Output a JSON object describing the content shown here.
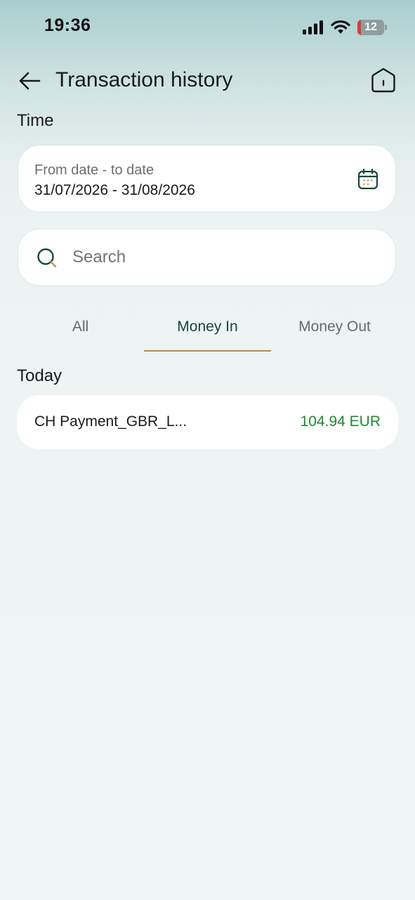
{
  "status_bar": {
    "time": "19:36",
    "battery_level": "12",
    "battery_fraction": 0.12,
    "icons": [
      "signal-icon",
      "wifi-icon",
      "battery-icon"
    ]
  },
  "header": {
    "title": "Transaction history",
    "back_icon": "arrow-left-icon",
    "home_icon": "home-icon"
  },
  "filters": {
    "time_label": "Time",
    "date_range": {
      "placeholder": "From date - to date",
      "value": "31/07/2026 - 31/08/2026",
      "icon": "calendar-icon"
    },
    "search": {
      "placeholder": "Search",
      "value": "",
      "icon": "search-icon"
    }
  },
  "tabs": {
    "items": [
      {
        "label": "All",
        "selected": false
      },
      {
        "label": "Money In",
        "selected": true
      },
      {
        "label": "Money Out",
        "selected": false
      }
    ]
  },
  "transactions": {
    "group_label": "Today",
    "items": [
      {
        "name": "CH Payment_GBR_L...",
        "amount": "104.94 EUR"
      }
    ]
  },
  "colors": {
    "accent": "#17463d",
    "tab_underline": "#b08d44",
    "income": "#1e8a2e",
    "battery_low": "#e0393e"
  }
}
